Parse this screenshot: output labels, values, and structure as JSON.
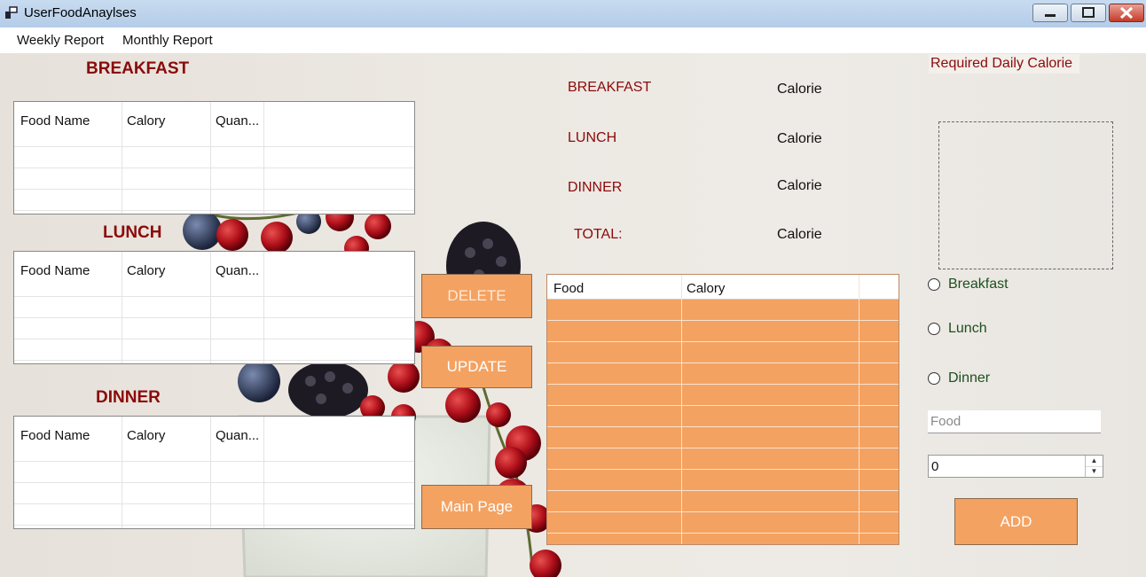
{
  "window": {
    "title": "UserFoodAnaylses"
  },
  "menu": {
    "items": [
      "Weekly Report",
      "Monthly Report"
    ]
  },
  "headings": {
    "breakfast": "BREAKFAST",
    "lunch": "LUNCH",
    "dinner": "DINNER"
  },
  "meal_grid": {
    "columns": [
      "Food Name",
      "Calory",
      "Quan..."
    ]
  },
  "buttons": {
    "delete": "DELETE",
    "update": "UPDATE",
    "main_page": "Main Page",
    "add": "ADD"
  },
  "summary": {
    "rows": [
      {
        "label": "BREAKFAST",
        "value": "Calorie"
      },
      {
        "label": "LUNCH",
        "value": "Calorie"
      },
      {
        "label": "DINNER",
        "value": "Calorie"
      },
      {
        "label": "TOTAL:",
        "value": "Calorie"
      }
    ]
  },
  "food_grid": {
    "columns": [
      "Food",
      "Calory"
    ]
  },
  "required_daily_calorie": "Required Daily Calorie",
  "meal_options": [
    "Breakfast",
    "Lunch",
    "Dinner"
  ],
  "food_input": {
    "placeholder": "Food",
    "value": ""
  },
  "quantity": {
    "value": "0"
  },
  "colors": {
    "accent": "#f4a261",
    "heading": "#8b0a0a",
    "radio_text": "#1d4f1d"
  }
}
